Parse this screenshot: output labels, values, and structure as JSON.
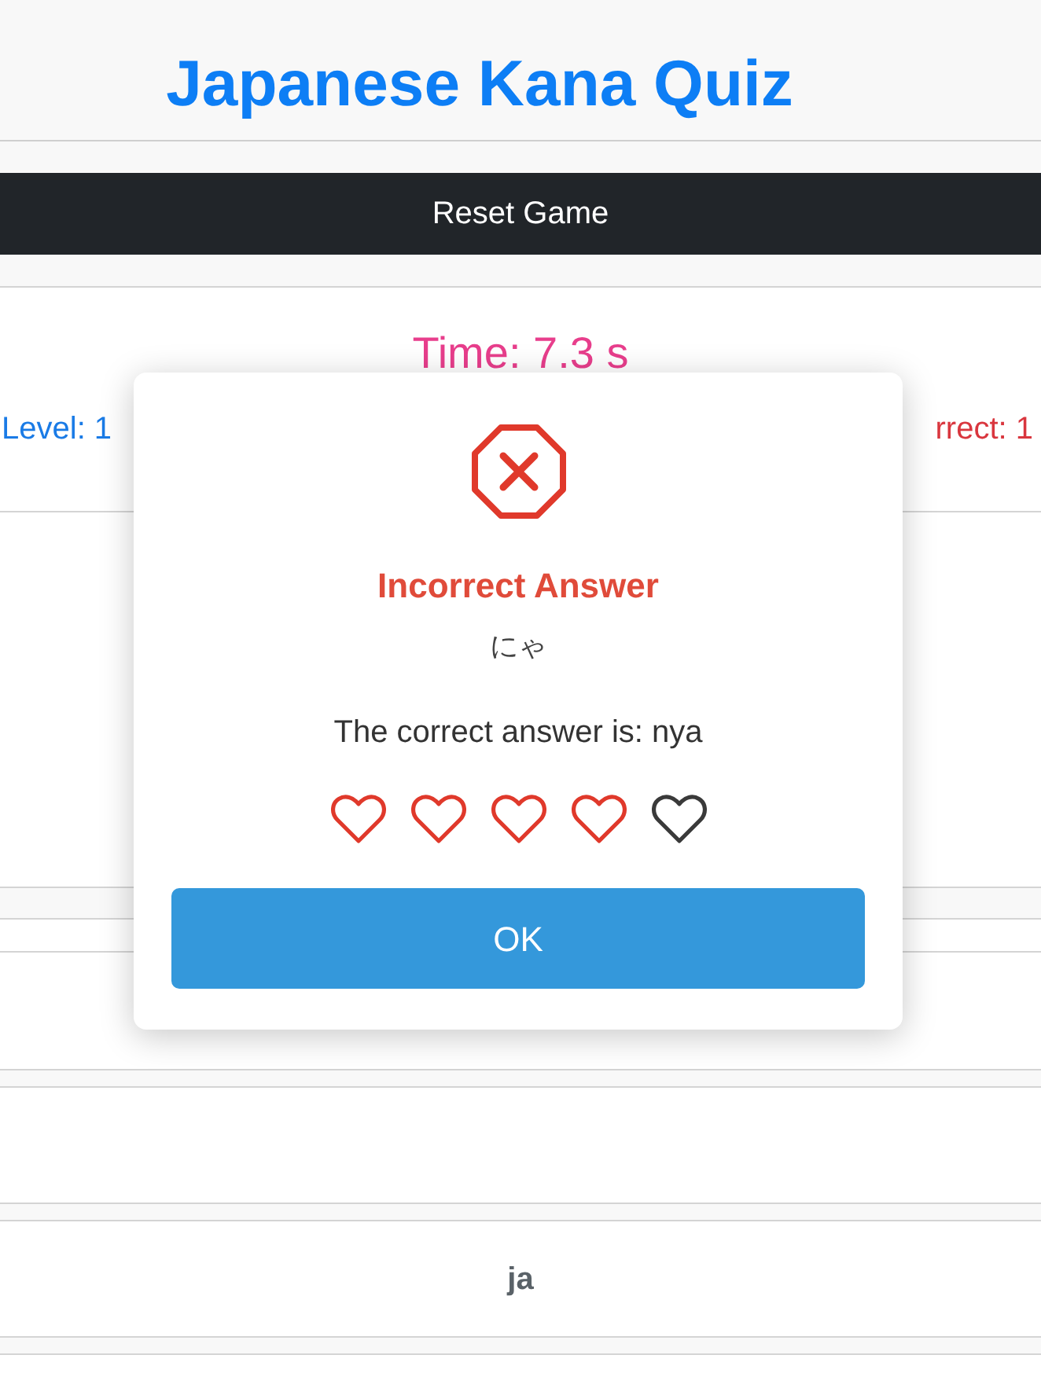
{
  "header": {
    "title": "Japanese Kana Quiz"
  },
  "reset_button": {
    "label": "Reset Game"
  },
  "stats": {
    "time": "Time: 7.3 s",
    "level": "Level: 1",
    "stat_right": "rrect: 1"
  },
  "answer_options": [
    {
      "kind": "blank"
    },
    {
      "kind": "blank"
    },
    {
      "kind": "text",
      "label": "ja"
    },
    {
      "kind": "blank"
    }
  ],
  "dialog": {
    "kind": "incorrect",
    "title": "Incorrect Answer",
    "kana": "にゃ",
    "message": "The correct answer is: nya",
    "hearts": [
      {
        "active": true
      },
      {
        "active": true
      },
      {
        "active": true
      },
      {
        "active": true
      },
      {
        "active": false
      }
    ],
    "button": "OK"
  }
}
